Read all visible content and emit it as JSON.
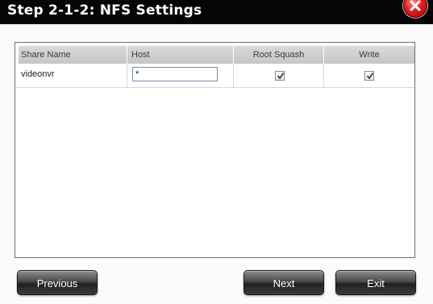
{
  "dialog": {
    "title": "Step 2-1-2: NFS Settings"
  },
  "table": {
    "columns": [
      "Share Name",
      "Host",
      "Root Squash",
      "Write"
    ],
    "rows": [
      {
        "share_name": "videonvr",
        "host": "*",
        "root_squash": true,
        "write": true
      }
    ]
  },
  "buttons": {
    "previous": "Previous",
    "next": "Next",
    "exit": "Exit"
  },
  "icons": {
    "close": "close-icon",
    "checkbox_checked": "checkmark-icon"
  },
  "colors": {
    "titlebar": "#050505",
    "close": "#e01f1f",
    "header": "#cfcfcf",
    "button": "#333333"
  }
}
